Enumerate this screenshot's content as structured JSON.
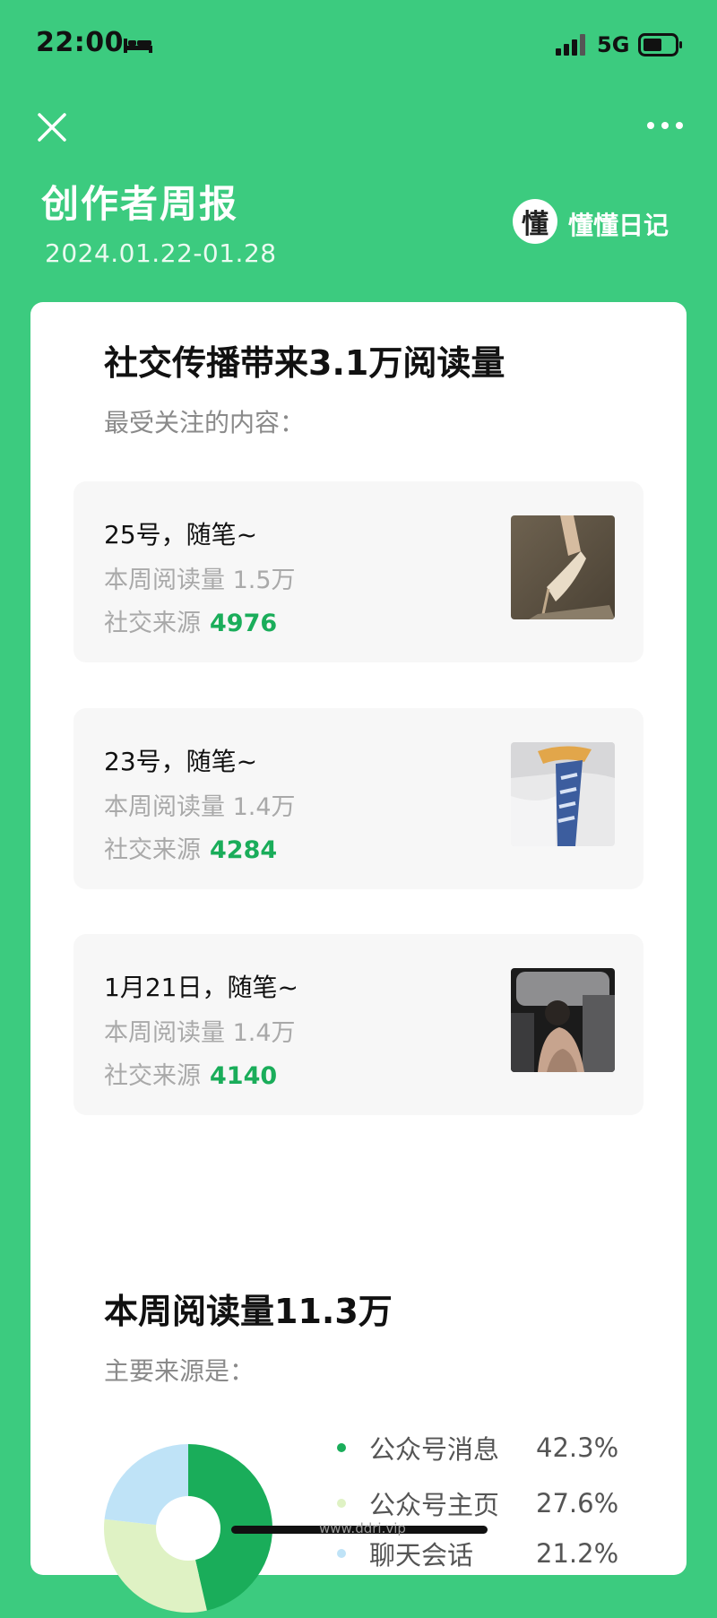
{
  "status": {
    "time": "22:00",
    "network": "5G"
  },
  "header": {
    "title": "创作者周报",
    "date_range": "2024.01.22-01.28",
    "account_logo_char": "懂",
    "account_name": "懂懂日记"
  },
  "social": {
    "title": "社交传播带来3.1万阅读量",
    "subtitle": "最受关注的内容：",
    "items": [
      {
        "title": "25号，随笔~",
        "read_label": "本周阅读量 1.5万",
        "social_label": "社交来源",
        "social_value": "4976",
        "thumb_icon": "shoe-photo"
      },
      {
        "title": "23号，随笔~",
        "read_label": "本周阅读量 1.4万",
        "social_label": "社交来源",
        "social_value": "4284",
        "thumb_icon": "scarf-photo"
      },
      {
        "title": "1月21日，随笔~",
        "read_label": "本周阅读量 1.4万",
        "social_label": "社交来源",
        "social_value": "4140",
        "thumb_icon": "car-photo"
      }
    ]
  },
  "weekly": {
    "title": "本周阅读量11.3万",
    "subtitle": "主要来源是：",
    "chart_data": {
      "type": "pie",
      "title": "",
      "categories": [
        "公众号消息",
        "公众号主页",
        "聊天会话"
      ],
      "values": [
        42.3,
        27.6,
        21.2
      ],
      "labels": [
        "42.3%",
        "27.6%",
        "21.2%"
      ],
      "colors": [
        "#1aad5a",
        "#dff2c4",
        "#bfe3f7"
      ]
    }
  },
  "watermark": "www.ddri.vip"
}
